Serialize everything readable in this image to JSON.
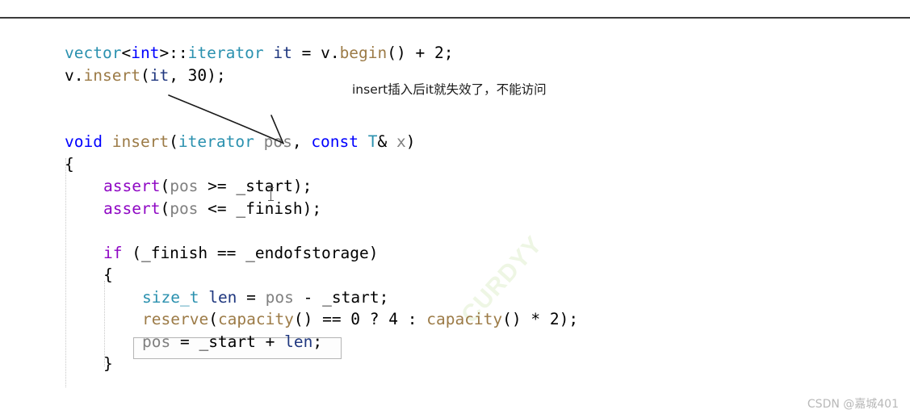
{
  "page": {
    "background_color": "#ffffff",
    "top_rule_color": "#3b3b3b"
  },
  "watermarks": {
    "corner": "CSDN @嘉城401",
    "diagonal": "CURDYY"
  },
  "annotation": {
    "note_text": "insert插入后it就失效了，不能访问",
    "arrow": "curved-arrow-from-insert-call-to-pos-parameter"
  },
  "palette": {
    "type": "#2b91af",
    "keyword": "#0000ff",
    "macro": "#8f08c4",
    "function": "#9c7b47",
    "variable": "#1f377f",
    "parameter": "#808080",
    "plain": "#000000",
    "box_border": "#b4b4b4",
    "guide": "#c8c8c8"
  },
  "code": {
    "lines": [
      {
        "id": "line-1",
        "indent": 0,
        "tokens": [
          {
            "text": "vector",
            "cls": "t-type"
          },
          {
            "text": "<",
            "cls": "t-punct"
          },
          {
            "text": "int",
            "cls": "t-kw"
          },
          {
            "text": ">::",
            "cls": "t-punct"
          },
          {
            "text": "iterator",
            "cls": "t-type"
          },
          {
            "text": " ",
            "cls": "t-plain"
          },
          {
            "text": "it",
            "cls": "t-var"
          },
          {
            "text": " = ",
            "cls": "t-plain"
          },
          {
            "text": "v",
            "cls": "t-plain"
          },
          {
            "text": ".",
            "cls": "t-punct"
          },
          {
            "text": "begin",
            "cls": "t-fn"
          },
          {
            "text": "() + 2;",
            "cls": "t-plain"
          }
        ]
      },
      {
        "id": "line-2",
        "indent": 0,
        "tokens": [
          {
            "text": "v",
            "cls": "t-plain"
          },
          {
            "text": ".",
            "cls": "t-punct"
          },
          {
            "text": "insert",
            "cls": "t-fn"
          },
          {
            "text": "(",
            "cls": "t-plain"
          },
          {
            "text": "it",
            "cls": "t-var"
          },
          {
            "text": ", 30);",
            "cls": "t-plain"
          }
        ]
      },
      {
        "id": "line-3",
        "indent": 0,
        "tokens": []
      },
      {
        "id": "line-4",
        "indent": 0,
        "tokens": []
      },
      {
        "id": "line-5",
        "indent": 0,
        "tokens": [
          {
            "text": "void",
            "cls": "t-kw"
          },
          {
            "text": " ",
            "cls": "t-plain"
          },
          {
            "text": "insert",
            "cls": "t-fn"
          },
          {
            "text": "(",
            "cls": "t-plain"
          },
          {
            "text": "iterator",
            "cls": "t-type"
          },
          {
            "text": " ",
            "cls": "t-plain"
          },
          {
            "text": "pos",
            "cls": "t-param"
          },
          {
            "text": ", ",
            "cls": "t-plain"
          },
          {
            "text": "const",
            "cls": "t-kw"
          },
          {
            "text": " ",
            "cls": "t-plain"
          },
          {
            "text": "T",
            "cls": "t-type"
          },
          {
            "text": "& ",
            "cls": "t-plain"
          },
          {
            "text": "x",
            "cls": "t-param"
          },
          {
            "text": ")",
            "cls": "t-plain"
          }
        ]
      },
      {
        "id": "line-6",
        "indent": 0,
        "tokens": [
          {
            "text": "{",
            "cls": "t-plain"
          }
        ]
      },
      {
        "id": "line-7",
        "indent": 1,
        "tokens": [
          {
            "text": "assert",
            "cls": "t-macro"
          },
          {
            "text": "(",
            "cls": "t-plain"
          },
          {
            "text": "pos",
            "cls": "t-param"
          },
          {
            "text": " >= _start);",
            "cls": "t-plain"
          }
        ]
      },
      {
        "id": "line-8",
        "indent": 1,
        "tokens": [
          {
            "text": "assert",
            "cls": "t-macro"
          },
          {
            "text": "(",
            "cls": "t-plain"
          },
          {
            "text": "pos",
            "cls": "t-param"
          },
          {
            "text": " <= _finish);",
            "cls": "t-plain"
          }
        ]
      },
      {
        "id": "line-9",
        "indent": 0,
        "tokens": []
      },
      {
        "id": "line-10",
        "indent": 1,
        "tokens": [
          {
            "text": "if",
            "cls": "t-macro"
          },
          {
            "text": " (_finish == _endofstorage)",
            "cls": "t-plain"
          }
        ]
      },
      {
        "id": "line-11",
        "indent": 1,
        "tokens": [
          {
            "text": "{",
            "cls": "t-plain"
          }
        ]
      },
      {
        "id": "line-12",
        "indent": 2,
        "tokens": [
          {
            "text": "size_t",
            "cls": "t-type"
          },
          {
            "text": " ",
            "cls": "t-plain"
          },
          {
            "text": "len",
            "cls": "t-var"
          },
          {
            "text": " = ",
            "cls": "t-plain"
          },
          {
            "text": "pos",
            "cls": "t-param"
          },
          {
            "text": " - _start;",
            "cls": "t-plain"
          }
        ]
      },
      {
        "id": "line-13",
        "indent": 2,
        "tokens": [
          {
            "text": "reserve",
            "cls": "t-fn"
          },
          {
            "text": "(",
            "cls": "t-plain"
          },
          {
            "text": "capacity",
            "cls": "t-fn"
          },
          {
            "text": "() == 0 ? 4 : ",
            "cls": "t-plain"
          },
          {
            "text": "capacity",
            "cls": "t-fn"
          },
          {
            "text": "() * 2);",
            "cls": "t-plain"
          }
        ]
      },
      {
        "id": "line-14",
        "indent": 2,
        "boxed": true,
        "tokens": [
          {
            "text": "pos",
            "cls": "t-param"
          },
          {
            "text": " = _start + ",
            "cls": "t-plain"
          },
          {
            "text": "len",
            "cls": "t-var"
          },
          {
            "text": ";",
            "cls": "t-plain"
          }
        ]
      },
      {
        "id": "line-15",
        "indent": 1,
        "tokens": [
          {
            "text": "}",
            "cls": "t-plain"
          }
        ]
      }
    ]
  }
}
